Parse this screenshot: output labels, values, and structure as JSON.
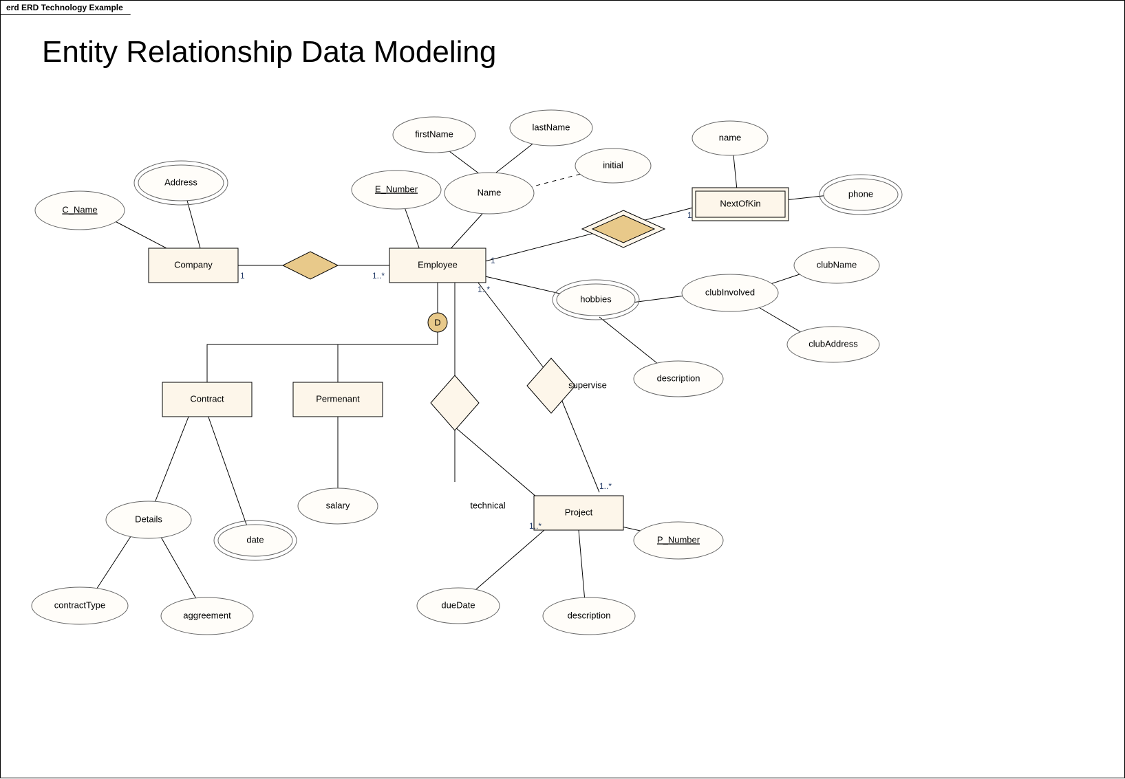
{
  "tab_label": "erd ERD Technology Example",
  "title": "Entity Relationship Data Modeling",
  "entities": {
    "company": "Company",
    "employee": "Employee",
    "nextofkin": "NextOfKin",
    "contract": "Contract",
    "permanent": "Permenant",
    "project": "Project"
  },
  "attributes": {
    "c_name": "C_Name",
    "address": "Address",
    "e_number": "E_Number",
    "name_comp": "Name",
    "first_name": "firstName",
    "last_name": "lastName",
    "initial": "initial",
    "kin_name": "name",
    "kin_phone": "phone",
    "hobbies": "hobbies",
    "description_hobby": "description",
    "club_involved": "clubInvolved",
    "club_name": "clubName",
    "club_address": "clubAddress",
    "details": "Details",
    "contract_type": "contractType",
    "aggreement": "aggreement",
    "date": "date",
    "salary": "salary",
    "p_number": "P_Number",
    "due_date": "dueDate",
    "proj_desc": "description"
  },
  "relationships": {
    "supervise": "supervise",
    "technical": "technical"
  },
  "cardinalities": {
    "company_side": "1",
    "employee_company": "1..*",
    "employee_kin": "1",
    "kin_employee": "1",
    "employee_proj": "1..*",
    "project_supervise": "1..*",
    "project_technical": "1..*"
  },
  "disjoint": "D"
}
